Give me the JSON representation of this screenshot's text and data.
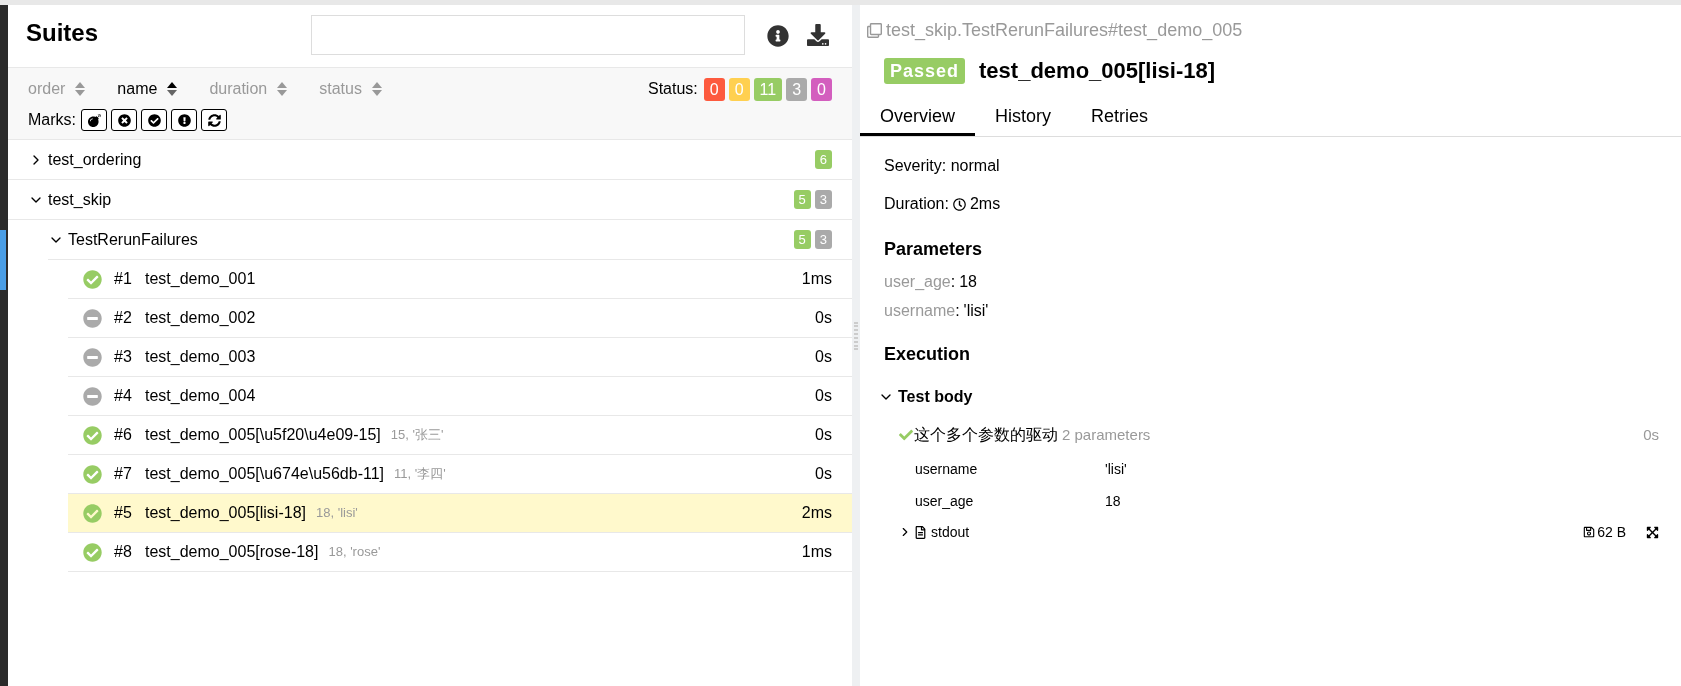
{
  "suites": {
    "title": "Suites",
    "sorters": [
      {
        "label": "order",
        "selected": false
      },
      {
        "label": "name",
        "selected": true
      },
      {
        "label": "duration",
        "selected": false
      },
      {
        "label": "status",
        "selected": false
      }
    ],
    "status_label": "Status:",
    "status_counts": [
      {
        "count": "0",
        "color": "#fd5a3e"
      },
      {
        "count": "0",
        "color": "#ffd050"
      },
      {
        "count": "11",
        "color": "#97cc64"
      },
      {
        "count": "3",
        "color": "#aaaaaa"
      },
      {
        "count": "0",
        "color": "#d35ebe"
      }
    ],
    "marks_label": "Marks:",
    "marks": [
      {
        "kind": "flaky"
      },
      {
        "kind": "new-failed"
      },
      {
        "kind": "new-passed"
      },
      {
        "kind": "new-broken"
      },
      {
        "kind": "retries"
      }
    ],
    "tree": [
      {
        "name": "test_ordering",
        "expanded": false,
        "counts": [
          {
            "count": "6",
            "color": "#97cc64"
          }
        ]
      },
      {
        "name": "test_skip",
        "expanded": true,
        "counts": [
          {
            "count": "5",
            "color": "#97cc64"
          },
          {
            "count": "3",
            "color": "#aaaaaa"
          }
        ],
        "children": [
          {
            "name": "TestRerunFailures",
            "expanded": true,
            "counts": [
              {
                "count": "5",
                "color": "#97cc64"
              },
              {
                "count": "3",
                "color": "#aaaaaa"
              }
            ],
            "tests": [
              {
                "kind": "passed",
                "order": "#1",
                "name": "test_demo_001",
                "duration": "1ms",
                "selected": false
              },
              {
                "kind": "skipped",
                "order": "#2",
                "name": "test_demo_002",
                "duration": "0s",
                "selected": false
              },
              {
                "kind": "skipped",
                "order": "#3",
                "name": "test_demo_003",
                "duration": "0s",
                "selected": false
              },
              {
                "kind": "skipped",
                "order": "#4",
                "name": "test_demo_004",
                "duration": "0s",
                "selected": false
              },
              {
                "kind": "passed",
                "order": "#6",
                "name": "test_demo_005[\\u5f20\\u4e09-15]",
                "params": "15, '张三'",
                "duration": "0s",
                "selected": false
              },
              {
                "kind": "passed",
                "order": "#7",
                "name": "test_demo_005[\\u674e\\u56db-11]",
                "params": "11, '李四'",
                "duration": "0s",
                "selected": false
              },
              {
                "kind": "passed",
                "order": "#5",
                "name": "test_demo_005[lisi-18]",
                "params": "18, 'lisi'",
                "duration": "2ms",
                "selected": true
              },
              {
                "kind": "passed",
                "order": "#8",
                "name": "test_demo_005[rose-18]",
                "params": "18, 'rose'",
                "duration": "1ms",
                "selected": false
              }
            ]
          }
        ]
      }
    ]
  },
  "detail": {
    "path": "test_skip.TestRerunFailures#test_demo_005",
    "status": "Passed",
    "title": "test_demo_005[lisi-18]",
    "tabs": [
      {
        "label": "Overview",
        "selected": true
      },
      {
        "label": "History",
        "selected": false
      },
      {
        "label": "Retries",
        "selected": false
      }
    ],
    "severity": "Severity: normal",
    "duration_label": "Duration:",
    "duration": "2ms",
    "parameters_heading": "Parameters",
    "parameters": [
      {
        "name": "user_age",
        "separator": ":",
        "value": "18"
      },
      {
        "name": "username",
        "separator": ":",
        "value": "'lisi'"
      }
    ],
    "execution_heading": "Execution",
    "test_body": {
      "label": "Test body",
      "expanded": true,
      "step": {
        "name": "这个多个参数的驱动",
        "params_count": "2 parameters",
        "duration": "0s",
        "params": [
          {
            "name": "username",
            "value": "'lisi'"
          },
          {
            "name": "user_age",
            "value": "18"
          }
        ]
      },
      "attachment": {
        "name": "stdout",
        "size": "62 B",
        "expanded": false
      }
    }
  }
}
